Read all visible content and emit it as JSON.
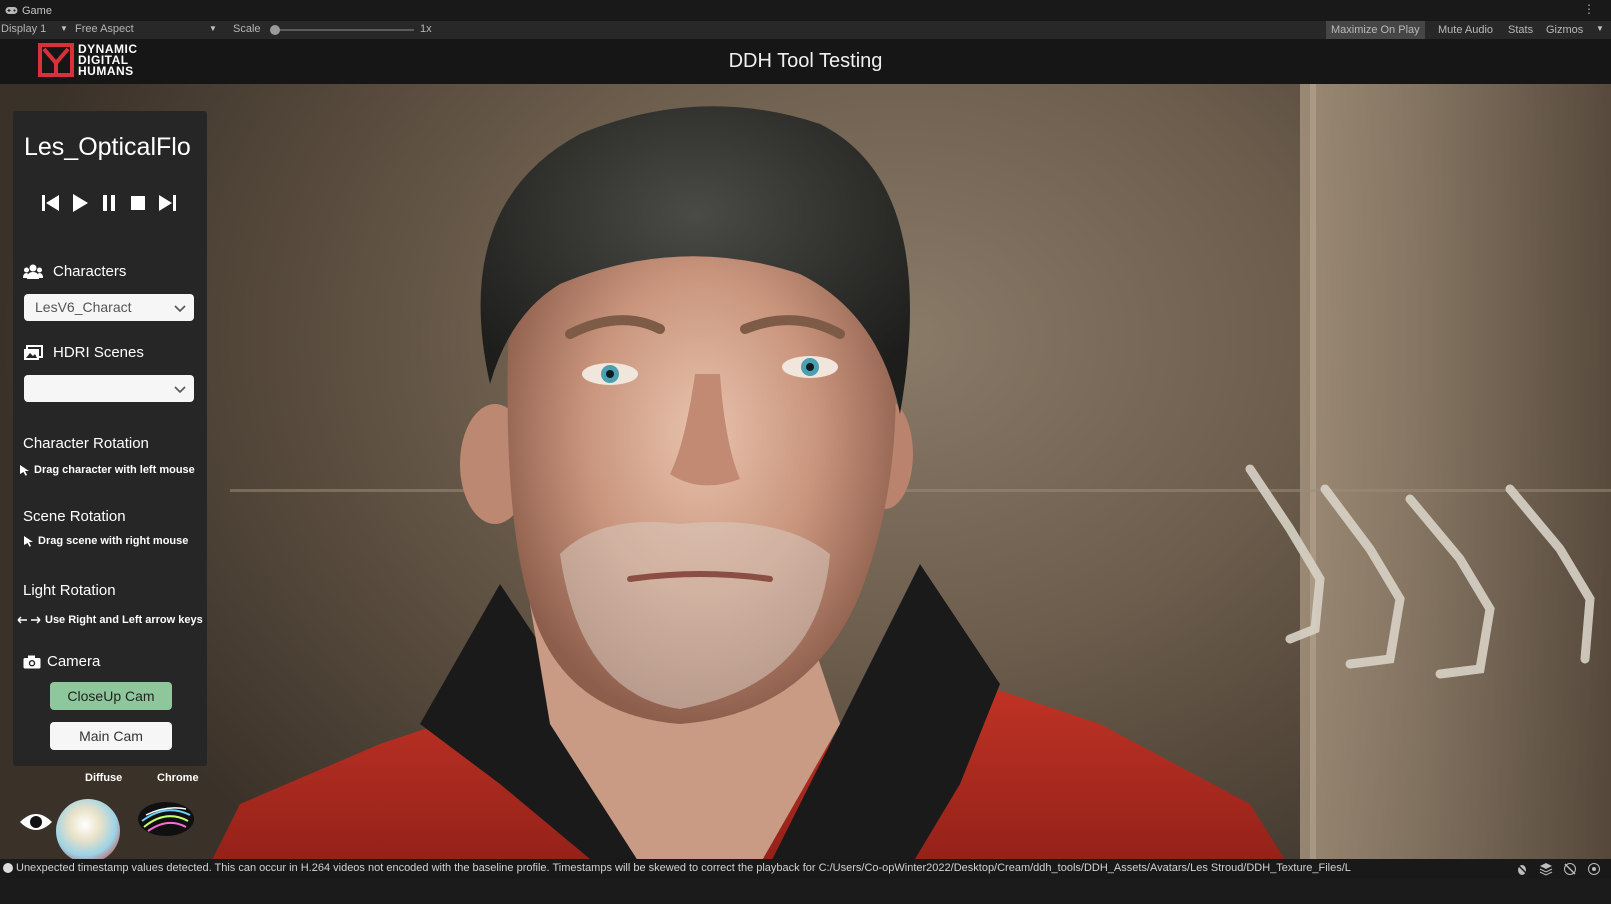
{
  "editor": {
    "tab_label": "Game",
    "more_label": "⋮",
    "display": "Display 1",
    "aspect": "Free Aspect",
    "scale_label": "Scale",
    "scale_value": 0,
    "scale_text": "1x",
    "buttons": {
      "maximize": "Maximize On Play",
      "mute": "Mute Audio",
      "stats": "Stats",
      "gizmos": "Gizmos"
    }
  },
  "app": {
    "logo_lines": [
      "DYNAMIC",
      "DIGITAL",
      "HUMANS"
    ],
    "title": "DDH Tool Testing"
  },
  "panel": {
    "clip_name": "Les_OpticalFlo",
    "transport": [
      "skip-back-icon",
      "play-icon",
      "pause-icon",
      "stop-icon",
      "skip-forward-icon"
    ],
    "characters": {
      "label": "Characters",
      "selected": "LesV6_Charact"
    },
    "hdri": {
      "label": "HDRI Scenes",
      "selected": ""
    },
    "character_rotation": {
      "label": "Character Rotation",
      "hint": "Drag character with left mouse"
    },
    "scene_rotation": {
      "label": "Scene Rotation",
      "hint": "Drag scene with right mouse"
    },
    "light_rotation": {
      "label": "Light Rotation",
      "hint": "Use Right and Left arrow keys"
    },
    "camera": {
      "label": "Camera",
      "closeup": "CloseUp Cam",
      "main": "Main Cam"
    }
  },
  "visualizers": {
    "diffuse": "Diffuse",
    "chrome": "Chrome"
  },
  "status": {
    "message": "Unexpected timestamp values detected. This can occur in H.264 videos not encoded with the baseline profile. Timestamps will be skewed to correct the playback for C:/Users/Co-opWinter2022/Desktop/Cream/ddh_tools/DDH_Assets/Avatars/Les Stroud/DDH_Texture_Files/L"
  },
  "colors": {
    "accent_green": "#8ec79b",
    "logo_red": "#d9313c",
    "panel_bg": "#262626"
  }
}
